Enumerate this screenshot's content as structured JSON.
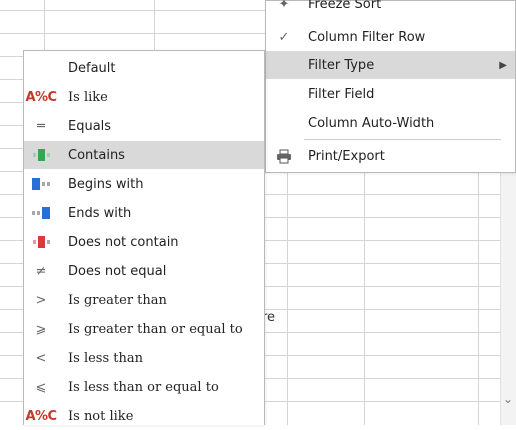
{
  "main_menu": {
    "items": [
      {
        "label": "Freeze Sort",
        "icon": "pin-icon"
      },
      {
        "label": "Column Filter Row",
        "icon": "checkmark-icon"
      },
      {
        "label": "Filter Type",
        "icon": "",
        "submenu_arrow": "▶"
      },
      {
        "label": "Filter Field",
        "icon": ""
      },
      {
        "label": "Column Auto-Width",
        "icon": ""
      },
      {
        "label": "Print/Export",
        "icon": "printer-icon"
      }
    ]
  },
  "submenu": {
    "items": [
      {
        "label": "Default",
        "icon": ""
      },
      {
        "label": "Is like",
        "icon": "like-icon",
        "glyph": "A%C"
      },
      {
        "label": "Equals",
        "icon": "equals-icon",
        "glyph": "═"
      },
      {
        "label": "Contains",
        "icon": "contains-icon"
      },
      {
        "label": "Begins with",
        "icon": "begins-with-icon"
      },
      {
        "label": "Ends with",
        "icon": "ends-with-icon"
      },
      {
        "label": "Does not contain",
        "icon": "does-not-contain-icon"
      },
      {
        "label": "Does not equal",
        "icon": "not-equal-icon",
        "glyph": "≠"
      },
      {
        "label": "Is greater than",
        "icon": "greater-than-icon",
        "glyph": ">"
      },
      {
        "label": "Is greater than or equal to",
        "icon": "greater-equal-icon",
        "glyph": "⩾"
      },
      {
        "label": "Is less than",
        "icon": "less-than-icon",
        "glyph": "<"
      },
      {
        "label": "Is less than or equal to",
        "icon": "less-equal-icon",
        "glyph": "⩽"
      },
      {
        "label": "Is not like",
        "icon": "not-like-icon",
        "glyph": "A%C"
      }
    ]
  },
  "grid": {
    "cell_text": "re"
  },
  "colors": {
    "highlight": "#d9d9d9",
    "contains_icon": "#2fa84f",
    "begins_ends_icon": "#2a6fd6",
    "not_contain_icon": "#d83b3b",
    "like_icon_text": "#c0392b"
  }
}
